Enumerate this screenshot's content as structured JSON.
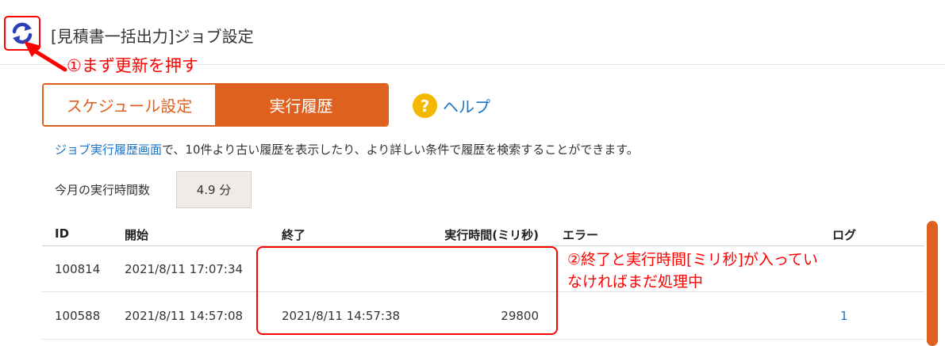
{
  "header": {
    "title": "[見積書一括出力]ジョブ設定",
    "refresh_icon": "refresh-icon"
  },
  "annotations": {
    "step1": "①まず更新を押す",
    "step2_line1": "②終了と実行時間[ミリ秒]が入ってい",
    "step2_line2": "なければまだ処理中"
  },
  "tabs": {
    "schedule": "スケジュール設定",
    "history": "実行履歴"
  },
  "help": {
    "icon_glyph": "?",
    "label": "ヘルプ"
  },
  "description": {
    "link": "ジョブ実行履歴画面",
    "text": "で、10件より古い履歴を表示したり、より詳しい条件で履歴を検索することができます。"
  },
  "usage": {
    "label": "今月の実行時間数",
    "value": "4.9 分"
  },
  "table": {
    "headers": {
      "id": "ID",
      "start": "開始",
      "end": "終了",
      "duration": "実行時間(ミリ秒)",
      "error": "エラー",
      "log": "ログ"
    },
    "rows": [
      {
        "id": "100814",
        "start": "2021/8/11 17:07:34",
        "end": "",
        "duration": "",
        "error": "",
        "log": ""
      },
      {
        "id": "100588",
        "start": "2021/8/11 14:57:08",
        "end": "2021/8/11 14:57:38",
        "duration": "29800",
        "error": "",
        "log": "1"
      }
    ]
  },
  "colors": {
    "accent": "#de6120",
    "link": "#1a73c8",
    "annotation": "#ff0000",
    "refresh_icon": "#2b3fb8",
    "help_icon": "#f5b800"
  }
}
